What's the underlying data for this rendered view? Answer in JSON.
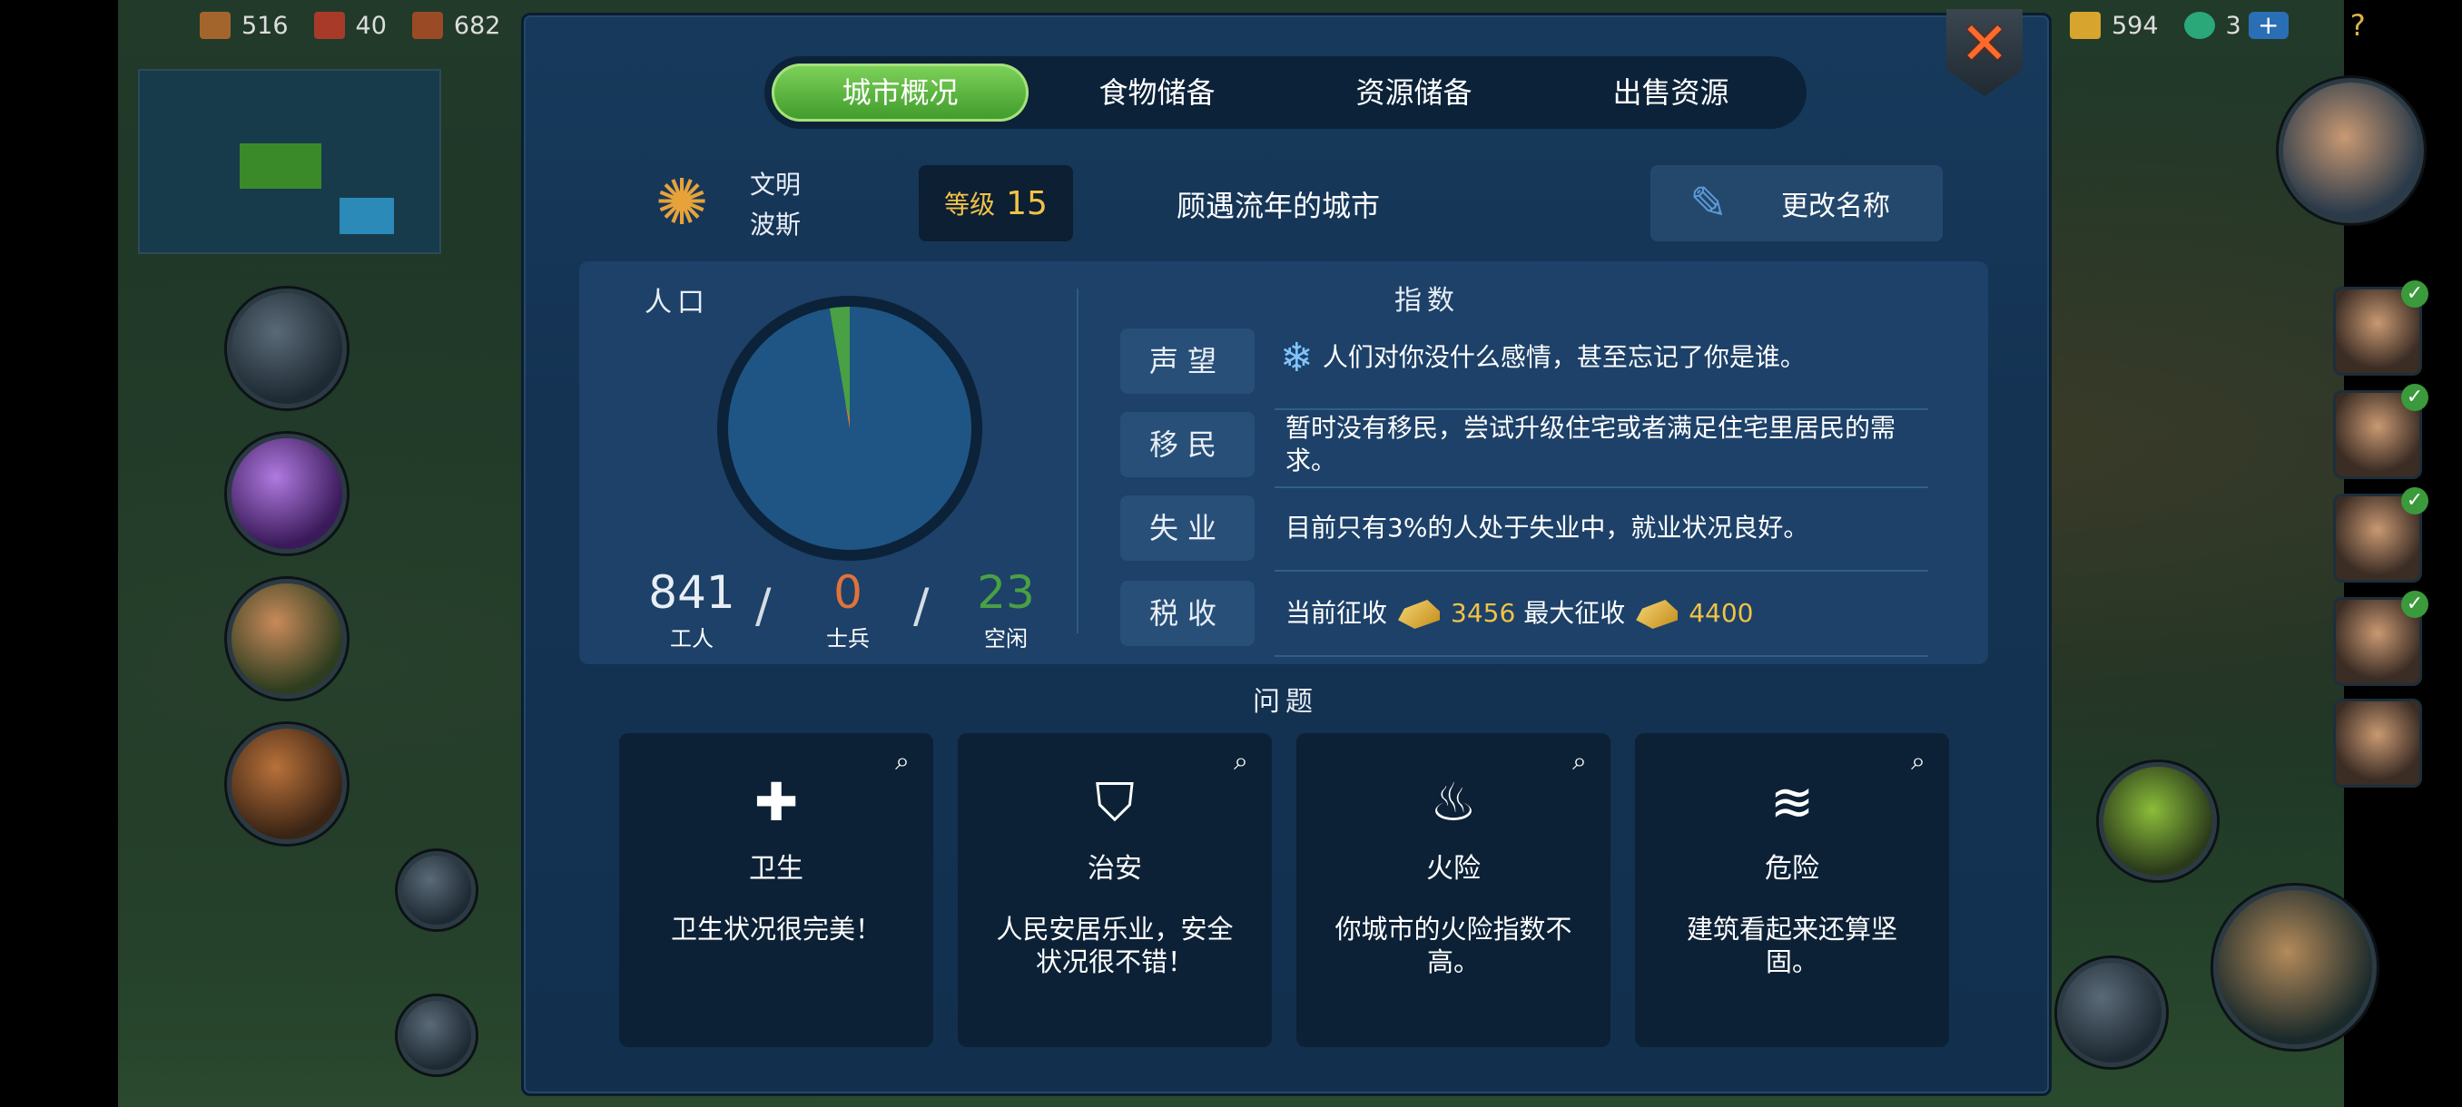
{
  "topbar": {
    "left": [
      {
        "icon": "wood-crate-icon",
        "value": "516"
      },
      {
        "icon": "brick-icon",
        "value": "40"
      },
      {
        "icon": "plank-icon",
        "value": "682"
      }
    ],
    "right": [
      {
        "icon": "gold-bar-icon",
        "value": "594"
      },
      {
        "icon": "gem-icon",
        "value": "3"
      }
    ],
    "plus": "+",
    "help": "?"
  },
  "tabs": [
    "城市概况",
    "食物储备",
    "资源储备",
    "出售资源"
  ],
  "header": {
    "civ_label": "文明",
    "civ_name": "波斯",
    "level_label": "等级",
    "level": "15",
    "city_name": "顾遇流年的城市",
    "rename": "更改名称"
  },
  "population": {
    "title": "人口",
    "workers": "841",
    "workers_label": "工人",
    "soldiers": "0",
    "soldiers_label": "士兵",
    "idle": "23",
    "idle_label": "空闲",
    "slash": "/"
  },
  "chart_data": {
    "type": "pie",
    "labels": [
      "工人",
      "士兵",
      "空闲"
    ],
    "values": [
      841,
      0,
      23
    ],
    "colors": [
      "#1f5584",
      "#e0733a",
      "#4aa044"
    ]
  },
  "indices": {
    "title": "指数",
    "rows": [
      {
        "tag": "声望",
        "text": "人们对你没什么感情，甚至忘记了你是谁。"
      },
      {
        "tag": "移民",
        "text": "暂时没有移民，尝试升级住宅或者满足住宅里居民的需求。"
      },
      {
        "tag": "失业",
        "text": "目前只有3%的人处于失业中，就业状况良好。"
      },
      {
        "tag": "税收",
        "current_label": "当前征收",
        "current": "3456",
        "max_label": "最大征收",
        "max": "4400"
      }
    ]
  },
  "problems": {
    "title": "问题",
    "cards": [
      {
        "icon": "cross-icon",
        "title": "卫生",
        "desc": "卫生状况很完美！"
      },
      {
        "icon": "shield-icon",
        "title": "治安",
        "desc": "人民安居乐业，安全状况很不错！"
      },
      {
        "icon": "fire-icon",
        "title": "火险",
        "desc": "你城市的火险指数不高。"
      },
      {
        "icon": "tornado-icon",
        "title": "危险",
        "desc": "建筑看起来还算坚固。"
      }
    ]
  },
  "colors": {
    "tab_active": "#5fb83e",
    "gold": "#f2c246",
    "soldiers": "#e0733a",
    "idle": "#4aa044"
  }
}
